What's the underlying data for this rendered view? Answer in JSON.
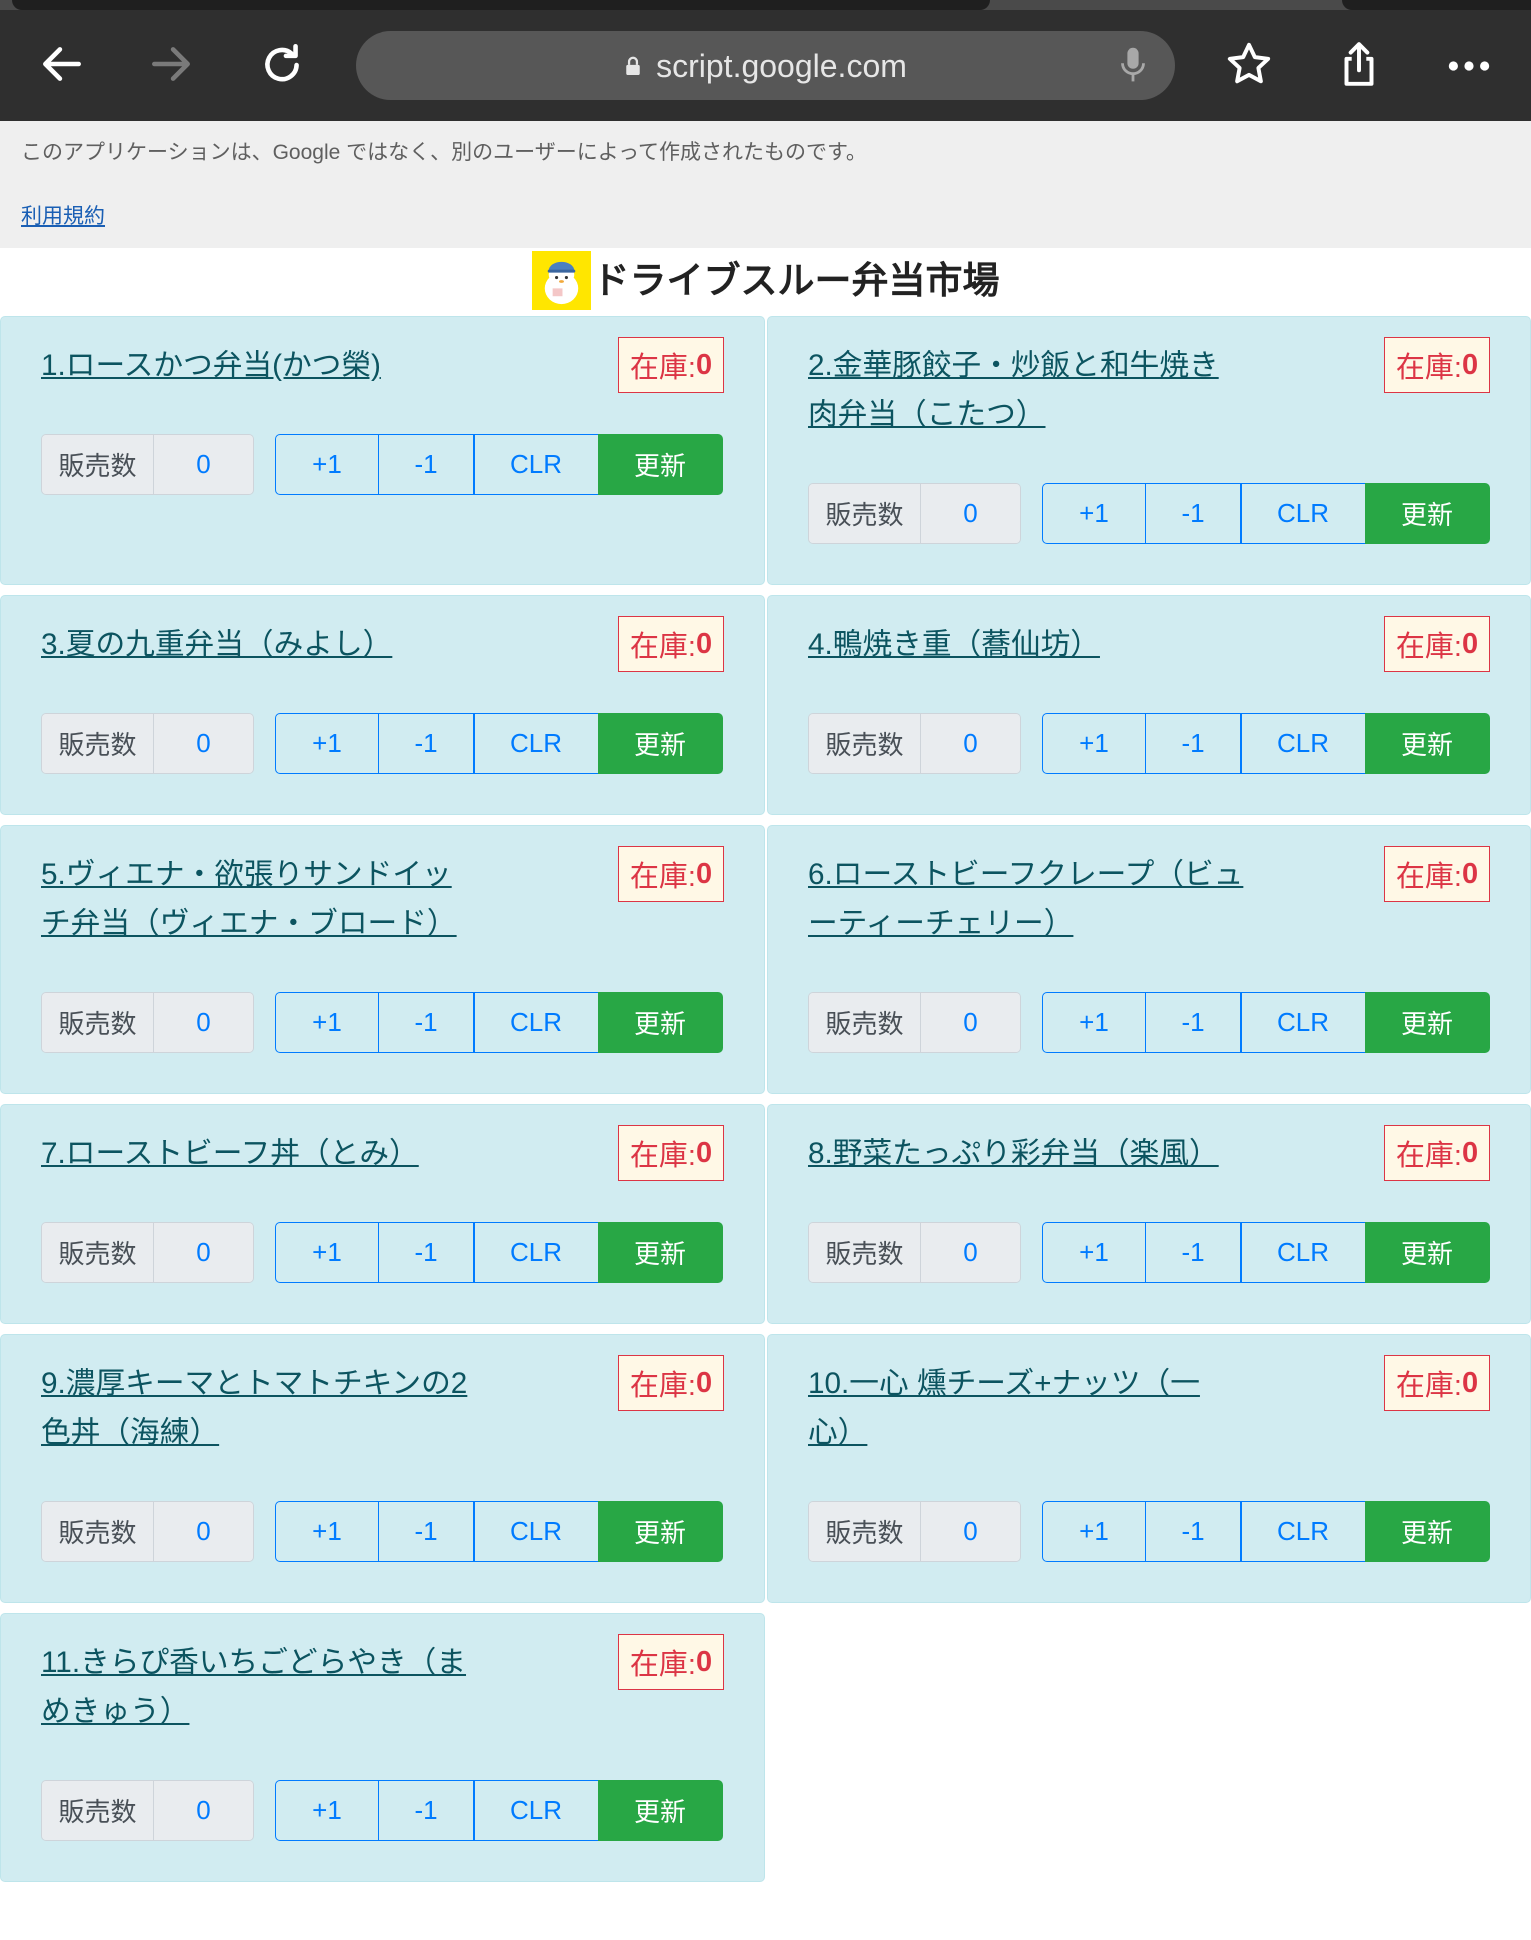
{
  "browser": {
    "url": "script.google.com"
  },
  "notice": {
    "text": "このアプリケーションは、Google ではなく、別のユーザーによって作成されたものです。",
    "terms_link": "利用規約"
  },
  "header": {
    "title": "ドライブスルー弁当市場"
  },
  "labels": {
    "stock": "在庫:",
    "sales": "販売数",
    "plus": "+1",
    "minus": "-1",
    "clear": "CLR",
    "update": "更新"
  },
  "colors": {
    "card_bg": "#d1ecf1",
    "stock_red": "#dc3545",
    "button_blue": "#007bff",
    "update_green": "#28a745"
  },
  "products": [
    {
      "title": "1.ロースかつ弁当(かつ榮)",
      "stock": "0",
      "sales": "0"
    },
    {
      "title": "2.金華豚餃子・炒飯と和牛焼き肉弁当（こたつ）",
      "stock": "0",
      "sales": "0"
    },
    {
      "title": "3.夏の九重弁当（みよし）",
      "stock": "0",
      "sales": "0"
    },
    {
      "title": "4.鴨焼き重（蕎仙坊）",
      "stock": "0",
      "sales": "0"
    },
    {
      "title": "5.ヴィエナ・欲張りサンドイッチ弁当（ヴィエナ・ブロード）",
      "stock": "0",
      "sales": "0"
    },
    {
      "title": "6.ローストビーフクレープ（ビューティーチェリー）",
      "stock": "0",
      "sales": "0"
    },
    {
      "title": "7.ローストビーフ丼（とみ）",
      "stock": "0",
      "sales": "0"
    },
    {
      "title": "8.野菜たっぷり彩弁当（楽風）",
      "stock": "0",
      "sales": "0"
    },
    {
      "title": "9.濃厚キーマとトマトチキンの2色丼（海練）",
      "stock": "0",
      "sales": "0"
    },
    {
      "title": "10.一心 燻チーズ+ナッツ（一心）",
      "stock": "0",
      "sales": "0"
    },
    {
      "title": "11.きらぴ香いちごどらやき（まめきゅう）",
      "stock": "0",
      "sales": "0"
    }
  ]
}
